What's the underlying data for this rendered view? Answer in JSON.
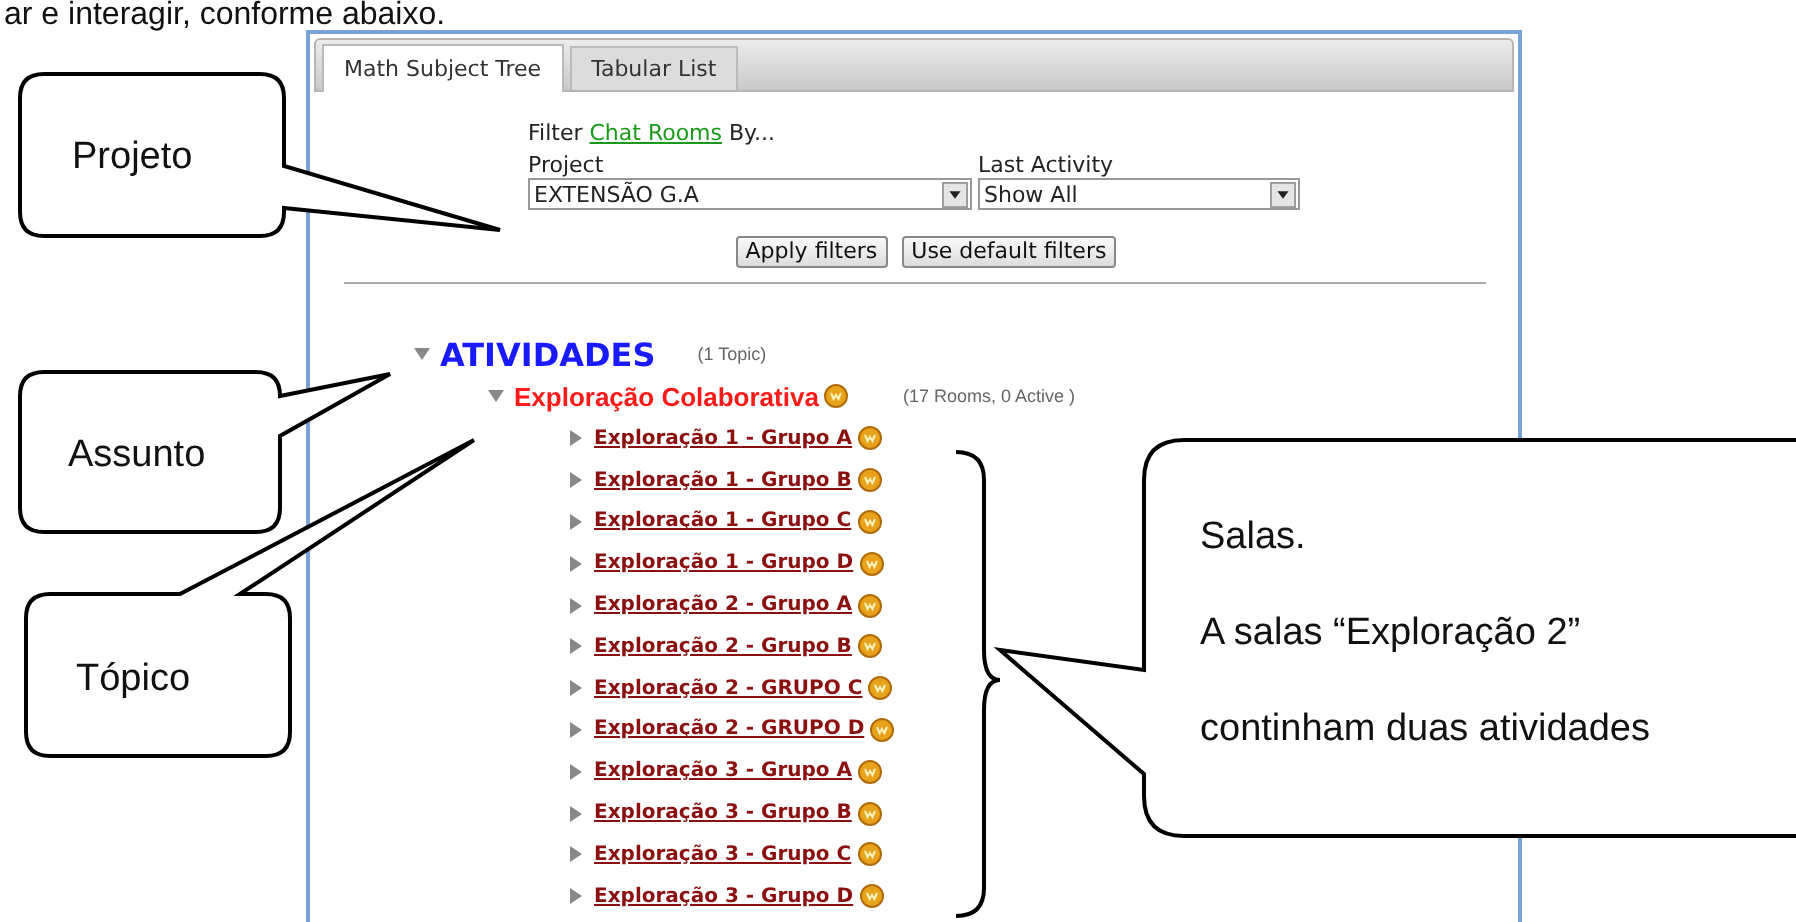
{
  "intro_text": "ar e interagir, conforme abaixo.",
  "tabs": [
    {
      "label": "Math Subject Tree",
      "selected": true
    },
    {
      "label": "Tabular List",
      "selected": false
    }
  ],
  "filter": {
    "prefix": "Filter",
    "link": "Chat Rooms",
    "suffix": "By...",
    "fields": [
      {
        "label": "Project",
        "value": "EXTENSÃO G.A"
      },
      {
        "label": "Last Activity",
        "value": "Show All"
      }
    ],
    "buttons": [
      "Apply filters",
      "Use default filters"
    ]
  },
  "tree": [
    {
      "label": "ATIVIDADES",
      "count": "(1 Topic)",
      "expanded": true,
      "children": [
        {
          "label": "Exploração Colaborativa",
          "count": "(17 Rooms, 0 Active )",
          "expanded": true,
          "children": [
            {
              "label": "Exploração 1 - Grupo A",
              "expanded": false
            },
            {
              "label": "Exploração 1 - Grupo B",
              "expanded": false
            },
            {
              "label": "Exploração 1 - Grupo C",
              "expanded": false
            },
            {
              "label": "Exploração 1 - Grupo D",
              "expanded": false
            },
            {
              "label": "Exploração 2 - Grupo A",
              "expanded": false
            },
            {
              "label": "Exploração 2 - Grupo B",
              "expanded": false
            },
            {
              "label": "Exploração 2 - GRUPO C",
              "expanded": false
            },
            {
              "label": "Exploração 2 - GRUPO D",
              "expanded": false
            },
            {
              "label": "Exploração 3 - Grupo A",
              "expanded": false
            },
            {
              "label": "Exploração 3 - Grupo B",
              "expanded": false
            },
            {
              "label": "Exploração 3 - Grupo C",
              "expanded": false
            },
            {
              "label": "Exploração 3 - Grupo D",
              "expanded": false
            }
          ]
        }
      ]
    }
  ],
  "callouts": [
    {
      "lines": [
        "Projeto"
      ]
    },
    {
      "lines": [
        "Assunto"
      ]
    },
    {
      "lines": [
        "Tópico"
      ]
    },
    {
      "lines": [
        "Salas.",
        "A salas “Exploração 2”",
        "continham duas atividades"
      ]
    }
  ]
}
